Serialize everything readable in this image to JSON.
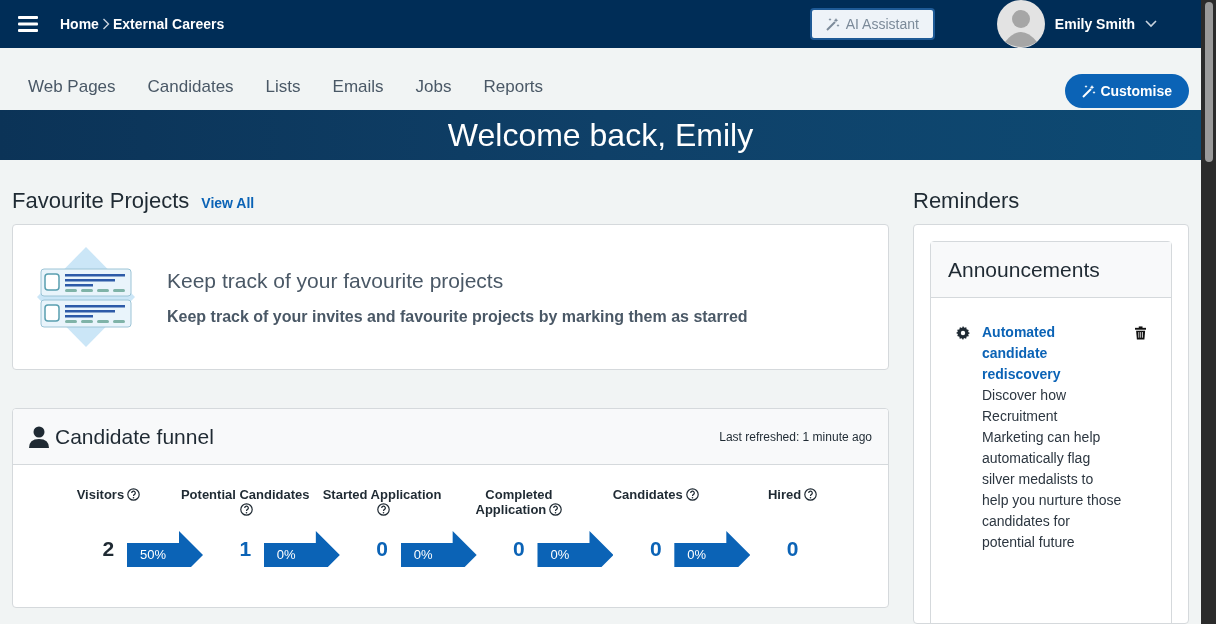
{
  "header": {
    "breadcrumb": [
      "Home",
      "External Careers"
    ],
    "ai_button": "AI Assistant",
    "user_name": "Emily Smith"
  },
  "nav": {
    "items": [
      "Web Pages",
      "Candidates",
      "Lists",
      "Emails",
      "Jobs",
      "Reports"
    ],
    "customise_button": "Customise"
  },
  "banner": {
    "title": "Welcome back, Emily"
  },
  "favourites": {
    "title": "Favourite Projects",
    "view_all": "View All",
    "empty_title": "Keep track of your favourite projects",
    "empty_text": "Keep track of your invites and favourite projects by marking them as starred"
  },
  "funnel": {
    "title": "Candidate funnel",
    "refreshed": "Last refreshed: 1 minute ago",
    "stages": [
      {
        "label": "Visitors",
        "value": "2",
        "highlighted": true,
        "conversion": "50%"
      },
      {
        "label": "Potential Candidates",
        "value": "1",
        "highlighted": false,
        "conversion": "0%"
      },
      {
        "label": "Started Application",
        "value": "0",
        "highlighted": false,
        "conversion": "0%"
      },
      {
        "label": "Completed Application",
        "value": "0",
        "highlighted": false,
        "conversion": "0%"
      },
      {
        "label": "Candidates",
        "value": "0",
        "highlighted": false,
        "conversion": "0%"
      },
      {
        "label": "Hired",
        "value": "0",
        "highlighted": false
      }
    ]
  },
  "reminders": {
    "title": "Reminders",
    "panel_title": "Announcements",
    "items": [
      {
        "title": "Automated candidate rediscovery",
        "text": "Discover how Recruitment Marketing can help automatically flag silver medalists to help you nurture those candidates for potential future"
      }
    ]
  }
}
